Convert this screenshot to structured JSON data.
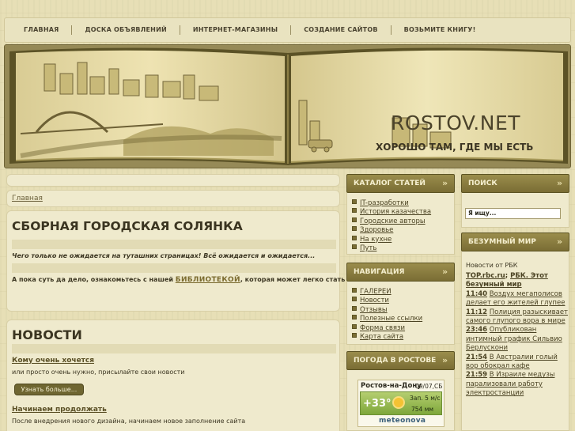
{
  "nav": {
    "items": [
      "ГЛАВНАЯ",
      "ДОСКА ОБЪЯВЛЕНИЙ",
      "ИНТЕРНЕТ-МАГАЗИНЫ",
      "СОЗДАНИЕ САЙТОВ",
      "ВОЗЬМИТЕ КНИГУ!"
    ]
  },
  "header": {
    "title": "ROSTOV.NET",
    "slogan": "ХОРОШО ТАМ, ГДЕ МЫ ЕСТЬ"
  },
  "breadcrumb": {
    "home": "Главная"
  },
  "article": {
    "title": "СБОРНАЯ ГОРОДСКАЯ СОЛЯНКА",
    "intro": "Чего только не ожидается на туташних страницах! Всё ожидается и ожидается...",
    "text_before": "А пока суть да дело, ознакомьтесь с нашей ",
    "library_link": "БИБЛИОТЕКОЙ",
    "text_after": ", которая может легко стать вашей!"
  },
  "news": {
    "heading": "НОВОСТИ",
    "items": [
      {
        "title": "Кому очень хочется",
        "text": "или просто очень нужно, присылайте свои новости",
        "button": "Узнать больше..."
      },
      {
        "title": "Начинаем продолжать",
        "text": "После внедрения нового дизайна, начинаем новое заполнение сайта"
      }
    ]
  },
  "catalog": {
    "heading": "КАТАЛОГ СТАТЕЙ",
    "items": [
      "IT-разработки",
      "История казачества",
      "Городские авторы",
      "Здоровье",
      "На кухне",
      "Путь"
    ]
  },
  "navigation": {
    "heading": "НАВИГАЦИЯ",
    "items": [
      "ГАЛЕРЕИ",
      "Новости",
      "Отзывы",
      "Полезные ссылки",
      "Форма связи",
      "Карта сайта"
    ]
  },
  "weather": {
    "heading": "ПОГОДА В РОСТОВЕ",
    "city": "Ростов-на-Дону",
    "date": "09/07,СБ",
    "temp": "+33°",
    "wind": "Зап. 5 м/с",
    "pressure": "754 мм",
    "brand": "meteonova"
  },
  "search": {
    "heading": "ПОИСК",
    "placeholder": "Я ищу..."
  },
  "crazy": {
    "heading": "БЕЗУМНЫЙ МИР",
    "source": "Новости от РБК",
    "links_line": [
      "TOP.rbc.ru",
      "РБК. Этот безумный мир"
    ],
    "items": [
      {
        "time": "11:40",
        "text": "Воздух мегаполисов делает его жителей глупее"
      },
      {
        "time": "11:12",
        "text": "Полиция разыскивает самого глупого вора в мире"
      },
      {
        "time": "23:46",
        "text": "Опубликован интимный график Сильвио Берлускони"
      },
      {
        "time": "21:54",
        "text": "В Австралии голый вор обокрал кафе"
      },
      {
        "time": "21:59",
        "text": "В Израиле медузы парализовали работу электростанции"
      }
    ]
  },
  "colors": {
    "background": "#e7dfb6",
    "block_header": "#8a7d40",
    "text": "#3b3521"
  }
}
